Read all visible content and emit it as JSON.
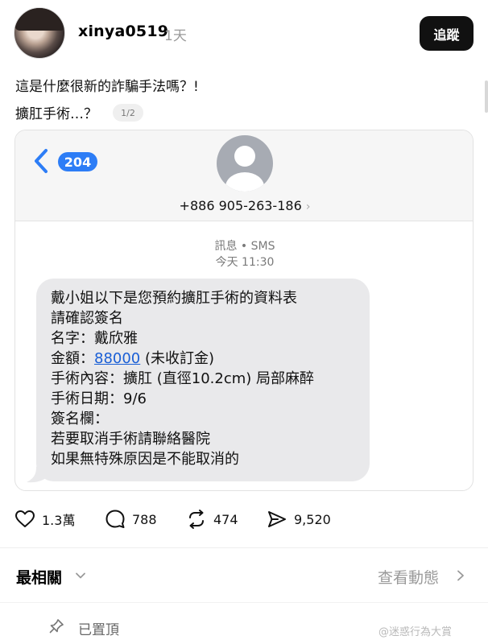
{
  "post": {
    "username": "xinya0519",
    "timestamp": "1天",
    "follow_label": "追蹤",
    "text_line1": "這是什麼很新的詐騙手法嗎？!",
    "text_line2": "擴肛手術…？",
    "image_counter": "1/2"
  },
  "sms": {
    "back_badge": "204",
    "contact_number": "+886 905-263-186",
    "contact_chevron": "›",
    "meta_label": "訊息 • SMS",
    "meta_time": "今天 11:30",
    "lines": [
      "戴小姐以下是您預約擴肛手術的資料表",
      "請確認簽名",
      "名字：戴欣雅"
    ],
    "amount_prefix": "金額：",
    "amount_link": "88000",
    "amount_suffix": " (未收訂金)",
    "lines_after": [
      "手術內容：擴肛 (直徑10.2cm) 局部麻醉",
      "手術日期：9/6",
      "簽名欄：",
      "若要取消手術請聯絡醫院",
      "如果無特殊原因是不能取消的"
    ]
  },
  "actions": {
    "likes": "1.3萬",
    "comments": "788",
    "reposts": "474",
    "shares": "9,520"
  },
  "sort": {
    "label": "最相關",
    "activity_link": "查看動態"
  },
  "pinned_label": "已置頂",
  "watermark": "@迷惑行為大賞",
  "icons": {
    "like": "heart-icon",
    "comment": "comment-icon",
    "repost": "repost-icon",
    "share": "send-icon",
    "pin": "pin-icon"
  }
}
